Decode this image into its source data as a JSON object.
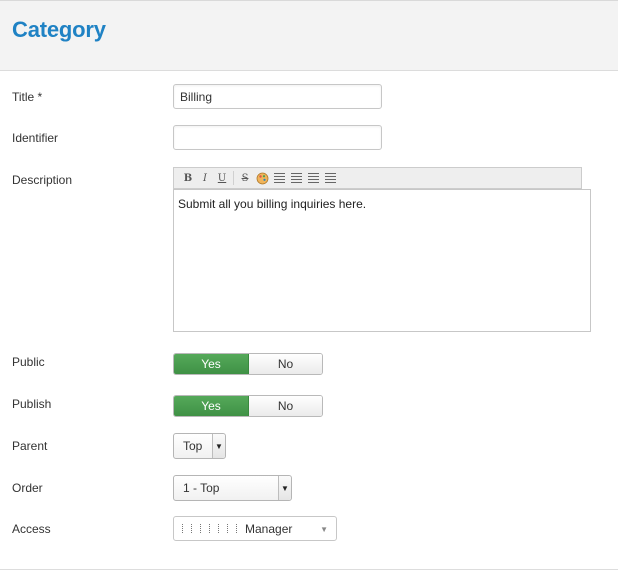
{
  "header": {
    "title": "Category"
  },
  "form": {
    "title": {
      "label": "Title *",
      "value": "Billing"
    },
    "identifier": {
      "label": "Identifier",
      "value": ""
    },
    "description": {
      "label": "Description",
      "toolbar": {
        "bold": "B",
        "italic": "I",
        "underline": "U",
        "strike": "S"
      },
      "value": "Submit all you billing inquiries here."
    },
    "public": {
      "label": "Public",
      "yes": "Yes",
      "no": "No",
      "selected": "Yes"
    },
    "publish": {
      "label": "Publish",
      "yes": "Yes",
      "no": "No",
      "selected": "Yes"
    },
    "parent": {
      "label": "Parent",
      "value": "Top"
    },
    "order": {
      "label": "Order",
      "value": "1 - Top"
    },
    "access": {
      "label": "Access",
      "value": "Manager"
    }
  },
  "colors": {
    "title_blue": "#1f82c4",
    "yes_green": "#4a9e4f"
  },
  "icons": [
    "bold-icon",
    "italic-icon",
    "underline-icon",
    "strikethrough-icon",
    "color-palette-icon",
    "ordered-list-icon",
    "unordered-list-icon",
    "outdent-icon",
    "indent-icon",
    "chevron-down-icon"
  ]
}
